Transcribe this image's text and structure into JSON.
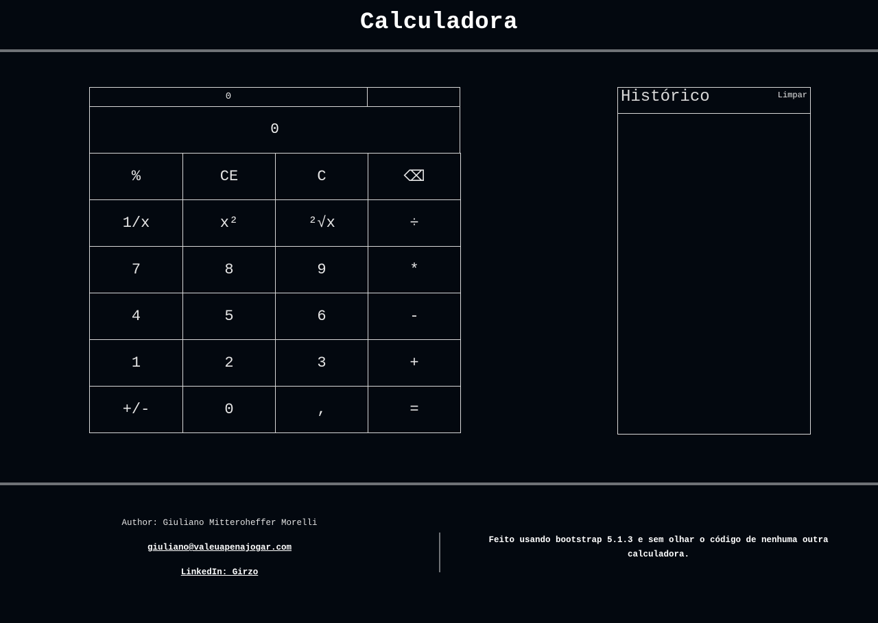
{
  "header": {
    "title": "Calculadora"
  },
  "calculator": {
    "previous_expression": "0",
    "previous_operator": "",
    "display_value": "0",
    "keys": [
      {
        "label": "%",
        "name": "percent-key"
      },
      {
        "label": "CE",
        "name": "clear-entry-key"
      },
      {
        "label": "C",
        "name": "clear-key"
      },
      {
        "label": "⌫",
        "name": "backspace-key"
      },
      {
        "label": "1/x",
        "name": "reciprocal-key"
      },
      {
        "label": "x²",
        "name": "square-key"
      },
      {
        "label": "²√x",
        "name": "square-root-key"
      },
      {
        "label": "÷",
        "name": "divide-key"
      },
      {
        "label": "7",
        "name": "digit-7-key"
      },
      {
        "label": "8",
        "name": "digit-8-key"
      },
      {
        "label": "9",
        "name": "digit-9-key"
      },
      {
        "label": "*",
        "name": "multiply-key"
      },
      {
        "label": "4",
        "name": "digit-4-key"
      },
      {
        "label": "5",
        "name": "digit-5-key"
      },
      {
        "label": "6",
        "name": "digit-6-key"
      },
      {
        "label": "-",
        "name": "subtract-key"
      },
      {
        "label": "1",
        "name": "digit-1-key"
      },
      {
        "label": "2",
        "name": "digit-2-key"
      },
      {
        "label": "3",
        "name": "digit-3-key"
      },
      {
        "label": "+",
        "name": "add-key"
      },
      {
        "label": "+/-",
        "name": "negate-key"
      },
      {
        "label": "0",
        "name": "digit-0-key"
      },
      {
        "label": ",",
        "name": "decimal-key"
      },
      {
        "label": "=",
        "name": "equals-key"
      }
    ]
  },
  "history": {
    "title": "Histórico",
    "clear_label": "Limpar"
  },
  "footer": {
    "author": "Author: Giuliano Mitteroheffer Morelli",
    "email": "giuliano@valeuapenajogar.com",
    "linkedin": "LinkedIn: Girzo",
    "note": "Feito usando bootstrap 5.1.3 e sem olhar o código de nenhuma outra calculadora."
  }
}
